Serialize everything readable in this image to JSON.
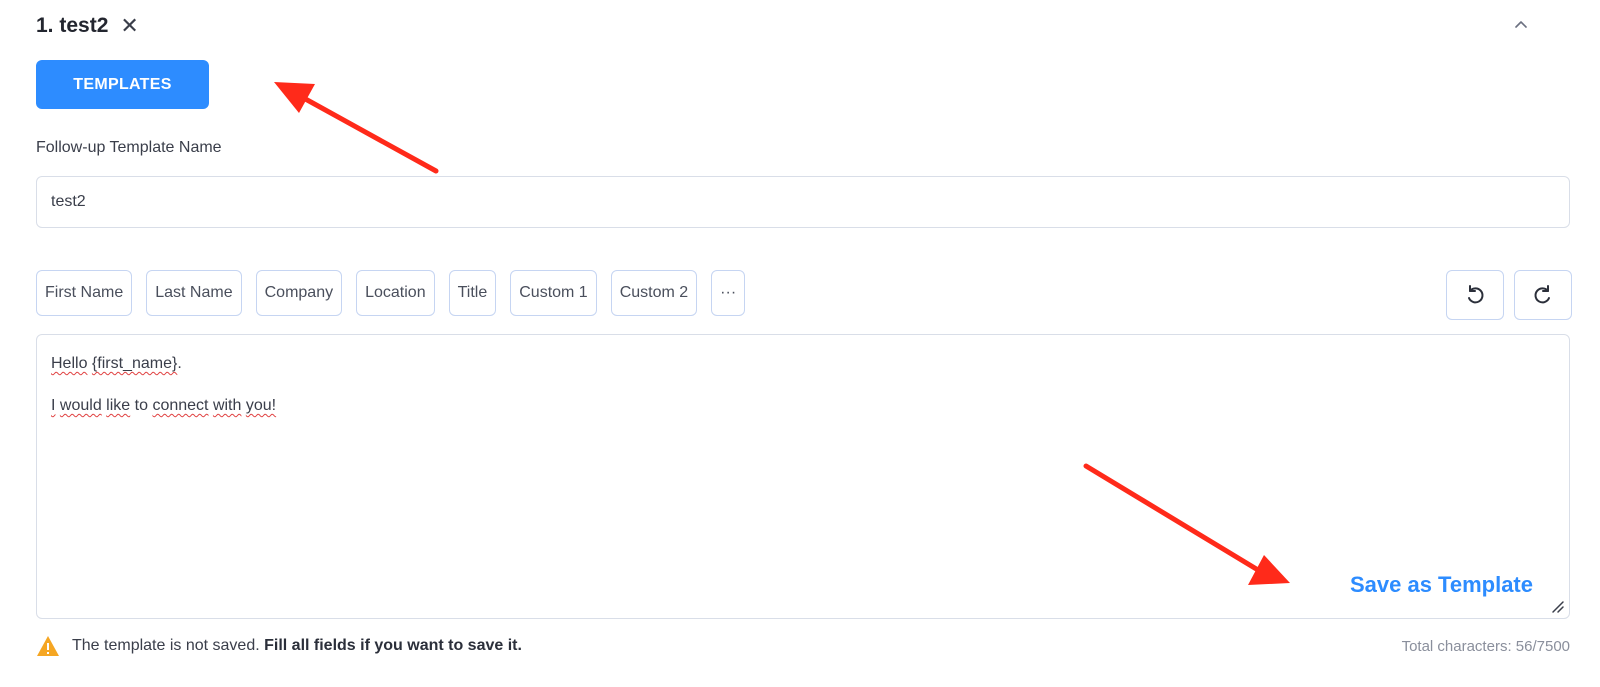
{
  "header": {
    "step_title": "1. test2",
    "close_symbol": "✕",
    "collapse_icon": "chevron-up-icon"
  },
  "templates_button": {
    "label": "TEMPLATES",
    "color": "#2d8cff"
  },
  "template_name": {
    "label": "Follow-up Template Name",
    "value": "test2"
  },
  "variables": [
    {
      "label": "First Name"
    },
    {
      "label": "Last Name"
    },
    {
      "label": "Company"
    },
    {
      "label": "Location"
    },
    {
      "label": "Title"
    },
    {
      "label": "Custom 1"
    },
    {
      "label": "Custom 2"
    },
    {
      "label": "···"
    }
  ],
  "history": {
    "undo_icon": "undo-icon",
    "redo_icon": "redo-icon"
  },
  "message": {
    "line1_a": "Hello",
    "line1_b": "{first_name}",
    "line1_c": ".",
    "line2_a": "I",
    "line2_b": "would",
    "line2_c": "like",
    "line2_d": "to",
    "line2_e": "connect",
    "line2_f": "with",
    "line2_g": "you!"
  },
  "save_as_template": {
    "label": "Save as Template",
    "color": "#2d8cff"
  },
  "warning": {
    "icon": "warning-triangle-icon",
    "text": "The template is not saved.",
    "bold_text": "Fill all fields if you want to save it."
  },
  "character_count": {
    "text": "Total characters: 56/7500"
  },
  "annotation_color": "#ff2a1a"
}
